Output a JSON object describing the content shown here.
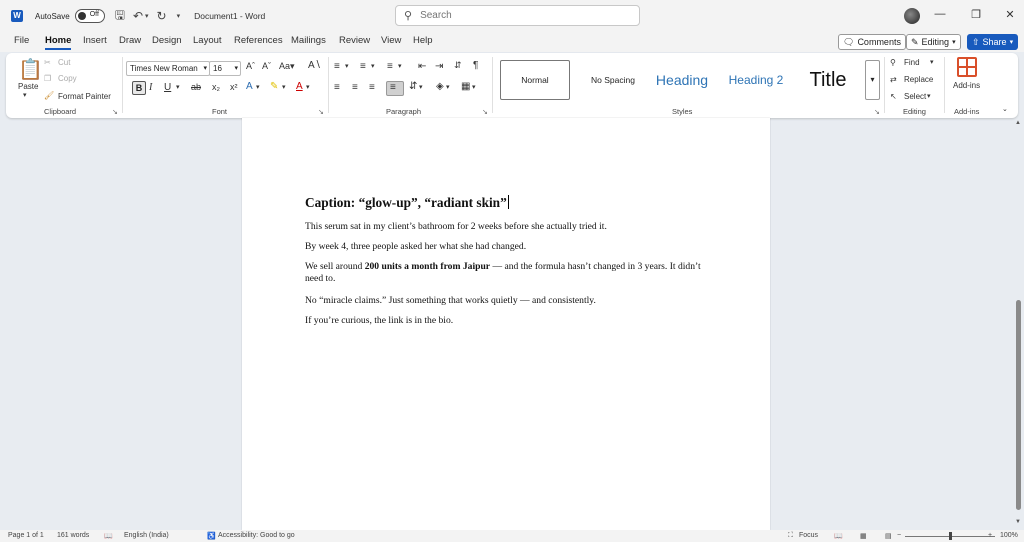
{
  "titlebar": {
    "autosave_label": "AutoSave",
    "autosave_state": "Off",
    "document_title": "Document1  -  Word",
    "search_placeholder": "Search"
  },
  "menu": {
    "tabs": [
      "File",
      "Home",
      "Insert",
      "Draw",
      "Design",
      "Layout",
      "References",
      "Mailings",
      "Review",
      "View",
      "Help"
    ],
    "active_tab": "Home",
    "comments_label": "Comments",
    "editing_label": "Editing",
    "share_label": "Share"
  },
  "ribbon": {
    "clipboard": {
      "paste": "Paste",
      "cut": "Cut",
      "copy": "Copy",
      "format_painter": "Format Painter",
      "label": "Clipboard"
    },
    "font": {
      "font_name": "Times New Roman",
      "font_size": "16",
      "label": "Font"
    },
    "paragraph": {
      "label": "Paragraph"
    },
    "styles": {
      "items": [
        "Normal",
        "No Spacing",
        "Heading",
        "Heading 2",
        "Title"
      ],
      "label": "Styles"
    },
    "editing": {
      "find": "Find",
      "replace": "Replace",
      "select": "Select",
      "label": "Editing"
    },
    "addins": {
      "button": "Add-ins",
      "label": "Add-ins"
    }
  },
  "document": {
    "caption": "Caption: “glow-up”, “radiant skin”",
    "p1": "This serum sat in my client’s bathroom for 2 weeks before she actually tried it.",
    "p2": "By week 4, three people asked her what she had changed.",
    "p3_pre": "We sell around ",
    "p3_bold": "200 units a month from Jaipur",
    "p3_post": " — and the formula hasn’t changed in 3 years. It didn’t need to.",
    "p4": "No “miracle claims.” Just something that works quietly — and consistently.",
    "p5": "If you’re curious, the link is in the bio."
  },
  "statusbar": {
    "page": "Page 1 of 1",
    "words": "161 words",
    "language": "English (India)",
    "accessibility": "Accessibility: Good to go",
    "focus": "Focus",
    "zoom": "100%"
  },
  "colors": {
    "accent": "#185abd",
    "heading_blue": "#2e74b5"
  }
}
